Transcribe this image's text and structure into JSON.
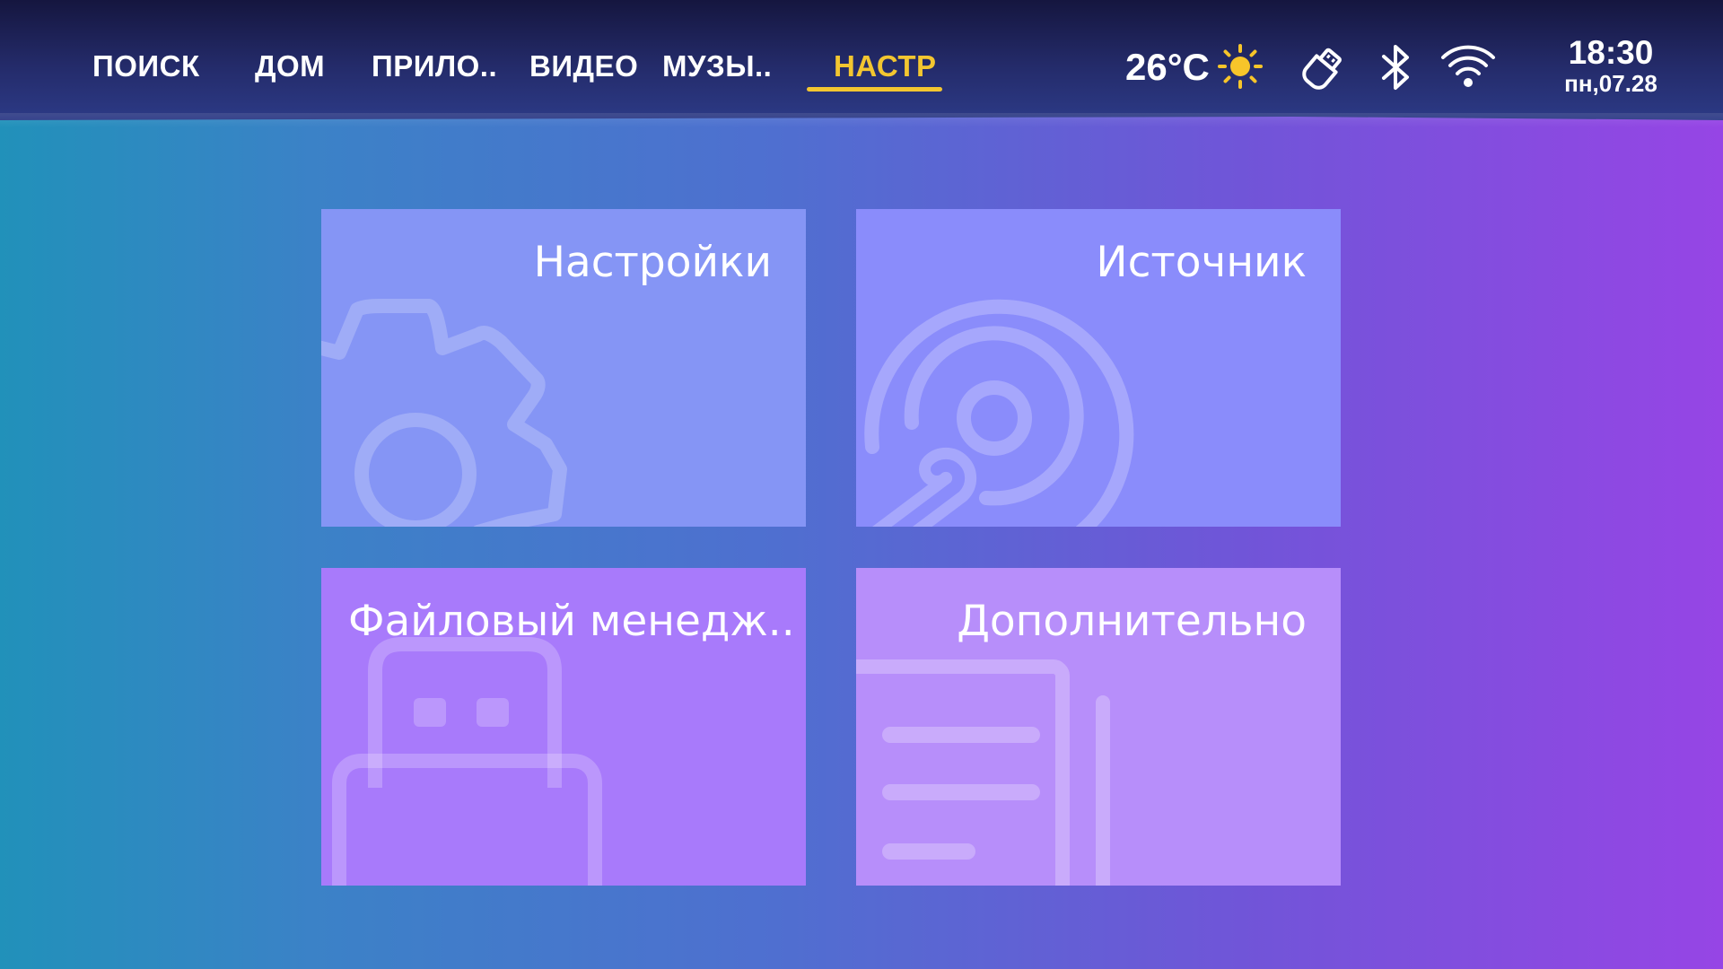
{
  "top_nav": {
    "items": [
      {
        "key": "search",
        "label": "ПОИСК"
      },
      {
        "key": "home",
        "label": "ДОМ"
      },
      {
        "key": "apps",
        "label": "ПРИЛО.."
      },
      {
        "key": "video",
        "label": "ВИДЕО"
      },
      {
        "key": "music",
        "label": "МУЗЫ.."
      },
      {
        "key": "settings",
        "label": "НАСТР"
      }
    ],
    "active": "settings"
  },
  "status": {
    "temperature": "26°C",
    "weather_icon": "sun-icon",
    "icons": [
      "usb-drive-icon",
      "bluetooth-icon",
      "wifi-icon"
    ],
    "time": "18:30",
    "date": "пн,07.28"
  },
  "tiles": [
    {
      "key": "settings",
      "label": "Настройки",
      "icon": "gear-icon",
      "color": "#8595f5"
    },
    {
      "key": "source",
      "label": "Источник",
      "icon": "source-disc-icon",
      "color": "#8a8cfb"
    },
    {
      "key": "file-manager",
      "label": "Файловый менедж..",
      "icon": "usb-drive-icon",
      "color": "#a87afb"
    },
    {
      "key": "more",
      "label": "Дополнительно",
      "icon": "document-icon",
      "color": "#b78efa"
    }
  ],
  "colors": {
    "accent": "#f3c630",
    "topbar": "#1c2054"
  }
}
